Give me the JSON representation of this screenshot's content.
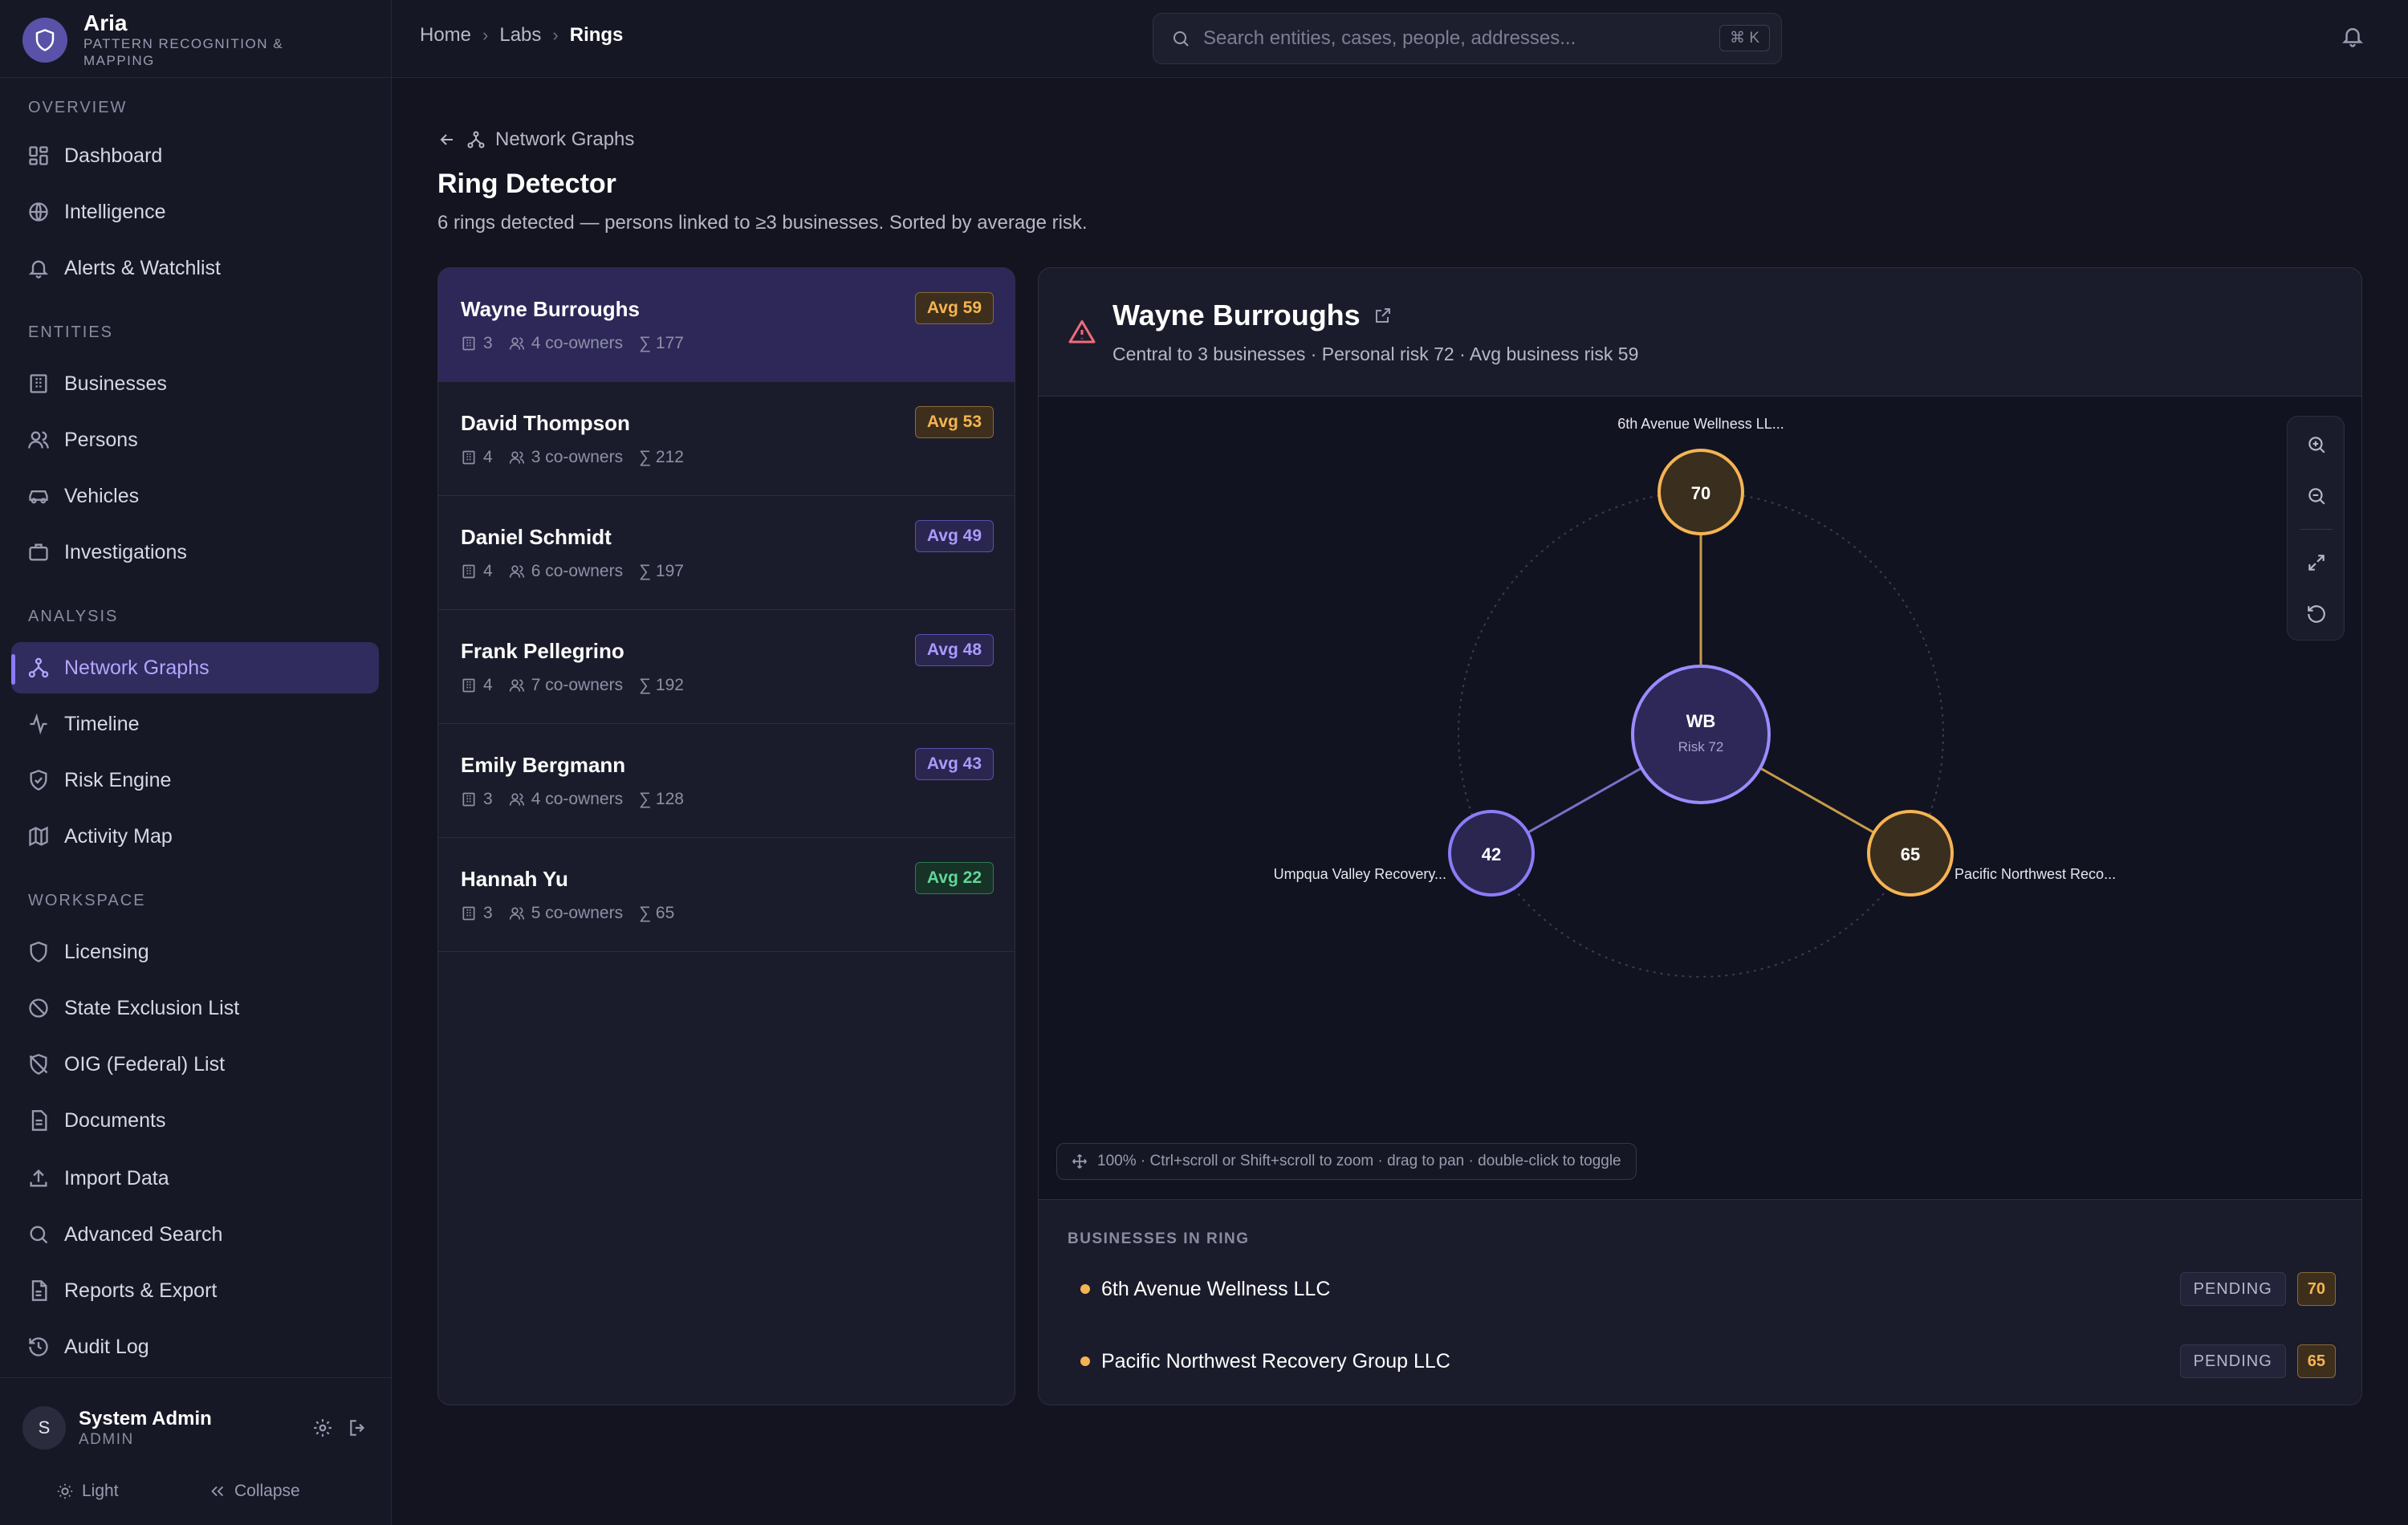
{
  "app": {
    "name": "Aria",
    "subtitle": "PATTERN RECOGNITION & MAPPING"
  },
  "sidebar": {
    "sections": {
      "overview": "OVERVIEW",
      "entities": "ENTITIES",
      "analysis": "ANALYSIS",
      "workspace": "WORKSPACE"
    },
    "items": {
      "dashboard": "Dashboard",
      "intelligence": "Intelligence",
      "alerts": "Alerts & Watchlist",
      "businesses": "Businesses",
      "persons": "Persons",
      "vehicles": "Vehicles",
      "investigations": "Investigations",
      "network_graphs": "Network Graphs",
      "timeline": "Timeline",
      "risk_engine": "Risk Engine",
      "activity_map": "Activity Map",
      "licensing": "Licensing",
      "state_exclusion": "State Exclusion List",
      "oig": "OIG (Federal) List",
      "documents": "Documents",
      "import": "Import Data",
      "advanced_search": "Advanced Search",
      "reports": "Reports & Export",
      "audit": "Audit Log"
    },
    "active_item": "network_graphs",
    "user": {
      "initial": "S",
      "name": "System Admin",
      "role": "ADMIN"
    },
    "theme_label": "Light",
    "collapse_label": "Collapse"
  },
  "topbar": {
    "breadcrumb": [
      "Home",
      "Labs",
      "Rings"
    ],
    "search_placeholder": "Search entities, cases, people, addresses...",
    "search_shortcut": "⌘ K"
  },
  "page": {
    "back_label": "Network Graphs",
    "title": "Ring Detector",
    "subtitle": "6 rings detected — persons linked to ≥3 businesses. Sorted by average risk."
  },
  "rings": [
    {
      "name": "Wayne Burroughs",
      "businesses": "3",
      "coowners": "4 co-owners",
      "sum": "∑ 177",
      "badge": "Avg 59",
      "tone": "orange",
      "selected": true
    },
    {
      "name": "David Thompson",
      "businesses": "4",
      "coowners": "3 co-owners",
      "sum": "∑ 212",
      "badge": "Avg 53",
      "tone": "orange",
      "selected": false
    },
    {
      "name": "Daniel Schmidt",
      "businesses": "4",
      "coowners": "6 co-owners",
      "sum": "∑ 197",
      "badge": "Avg 49",
      "tone": "purple",
      "selected": false
    },
    {
      "name": "Frank Pellegrino",
      "businesses": "4",
      "coowners": "7 co-owners",
      "sum": "∑ 192",
      "badge": "Avg 48",
      "tone": "purple",
      "selected": false
    },
    {
      "name": "Emily Bergmann",
      "businesses": "3",
      "coowners": "4 co-owners",
      "sum": "∑ 128",
      "badge": "Avg 43",
      "tone": "purple",
      "selected": false
    },
    {
      "name": "Hannah Yu",
      "businesses": "3",
      "coowners": "5 co-owners",
      "sum": "∑ 65",
      "badge": "Avg 22",
      "tone": "green",
      "selected": false
    }
  ],
  "detail": {
    "name": "Wayne Burroughs",
    "subtitle": "Central to 3 businesses · Personal risk 72 · Avg business risk 59",
    "graph": {
      "center": {
        "initials": "WB",
        "risk_label": "Risk 72"
      },
      "nodes": [
        {
          "score": "70",
          "label": "6th Avenue Wellness LL..."
        },
        {
          "score": "42",
          "label": "Umpqua Valley Recovery..."
        },
        {
          "score": "65",
          "label": "Pacific Northwest Reco..."
        }
      ],
      "hint": "100% · Ctrl+scroll or Shift+scroll to zoom · drag to pan · double-click to toggle"
    },
    "businesses_label": "BUSINESSES IN RING",
    "businesses": [
      {
        "name": "6th Avenue Wellness LLC",
        "status": "PENDING",
        "score": "70"
      },
      {
        "name": "Pacific Northwest Recovery Group LLC",
        "status": "PENDING",
        "score": "65"
      }
    ]
  },
  "colors": {
    "accent": "#8b7cf8",
    "warning": "#f5b453",
    "success": "#5fd79a",
    "danger": "#f06b7a"
  }
}
